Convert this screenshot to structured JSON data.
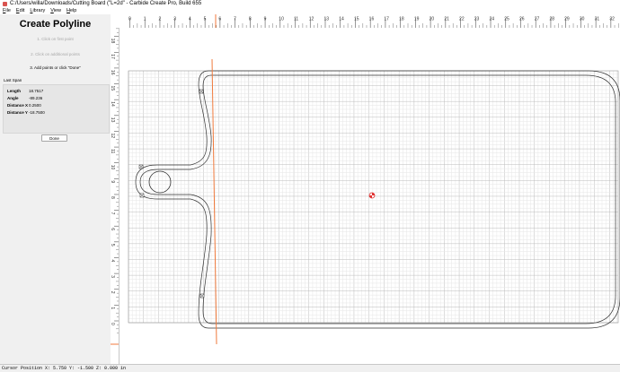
{
  "window": {
    "title": "C:/Users/willa/Downloads/Cutting Board (\"L=2d\" - Carbide Create Pro, Build 655"
  },
  "menu": [
    {
      "accel": "F",
      "rest": "ile"
    },
    {
      "accel": "E",
      "rest": "dit"
    },
    {
      "accel": "L",
      "rest": "ibrary"
    },
    {
      "accel": "V",
      "rest": "iew"
    },
    {
      "accel": "H",
      "rest": "elp"
    }
  ],
  "panel": {
    "title": "Create Polyline",
    "steps": [
      {
        "text": "1. Click on first point",
        "active": false
      },
      {
        "text": "2. Click on additional points",
        "active": false
      },
      {
        "text": "3. Add points or click \"Done\"",
        "active": true
      }
    ],
    "last_span_label": "Last Span",
    "stats": [
      {
        "label": "Length",
        "value": "18.7517"
      },
      {
        "label": "Angle",
        "value": "-89.236"
      },
      {
        "label": "Distance X",
        "value": "0.2500"
      },
      {
        "label": "Distance Y",
        "value": "-18.7500"
      }
    ],
    "done_label": "Done"
  },
  "ruler": {
    "top_numbers": [
      "0",
      "1",
      "2",
      "3",
      "4",
      "5",
      "6",
      "7",
      "8",
      "9",
      "10",
      "11",
      "12",
      "13",
      "14",
      "15",
      "16",
      "17",
      "18",
      "19",
      "20",
      "21",
      "22",
      "23",
      "24",
      "25",
      "26",
      "27",
      "28",
      "29",
      "30",
      "31",
      "32"
    ],
    "left_numbers": [
      "19",
      "18",
      "17",
      "16",
      "15",
      "14",
      "13",
      "12",
      "11",
      "10",
      "9",
      "8",
      "7",
      "6",
      "5",
      "4",
      "3",
      "2",
      "1",
      "0"
    ]
  },
  "colors": {
    "cursor_line": "#f07a3c",
    "grid_minor": "#e6e6e6",
    "grid_major": "#bcbcbc",
    "outline": "#333333",
    "origin_marker": "#e03030"
  },
  "status": {
    "cursor": "Cursor Position X: 5.750 Y: -1.500 Z: 0.000 in"
  }
}
